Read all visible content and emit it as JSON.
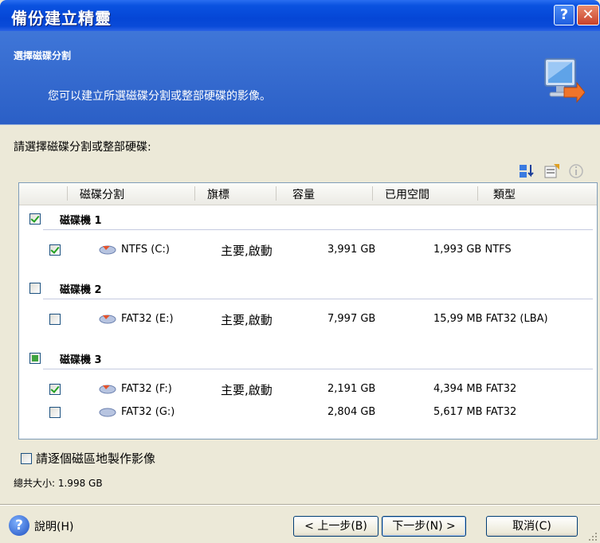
{
  "window": {
    "title": "備份建立精靈",
    "help_button": "?",
    "close_button": "✕"
  },
  "header": {
    "step_title": "選擇磁碟分割",
    "step_description": "您可以建立所選磁碟分割或整部硬碟的影像。"
  },
  "prompt": "請選擇磁碟分割或整部硬碟:",
  "toolbar_icons": [
    "sort-icon",
    "properties-icon",
    "info-icon"
  ],
  "columns": [
    "磁碟分割",
    "旗標",
    "容量",
    "已用空間",
    "類型"
  ],
  "disks": [
    {
      "label": "磁碟機 1",
      "state": "checked",
      "partitions": [
        {
          "name": "NTFS (C:)",
          "flags": "主要,啟動",
          "capacity": "3,991 GB",
          "used_type": "1,993 GB NTFS",
          "checked": true
        }
      ]
    },
    {
      "label": "磁碟機 2",
      "state": "unchecked",
      "partitions": [
        {
          "name": "FAT32 (E:)",
          "flags": "主要,啟動",
          "capacity": "7,997 GB",
          "used_type": "15,99 MB FAT32 (LBA)",
          "checked": false
        }
      ]
    },
    {
      "label": "磁碟機 3",
      "state": "partial",
      "partitions": [
        {
          "name": "FAT32 (F:)",
          "flags": "主要,啟動",
          "capacity": "2,191 GB",
          "used_type": "4,394 MB FAT32",
          "checked": true
        },
        {
          "name": "FAT32 (G:)",
          "flags": "",
          "capacity": "2,804 GB",
          "used_type": "5,617 MB FAT32",
          "checked": false
        }
      ]
    }
  ],
  "sector_by_sector_label": "請逐個磁區地製作影像",
  "total_size": "總共大小: 1.998 GB",
  "footer": {
    "help": "說明(H)",
    "back": "< 上一步(B)",
    "next": "下一步(N) >",
    "cancel": "取消(C)"
  }
}
